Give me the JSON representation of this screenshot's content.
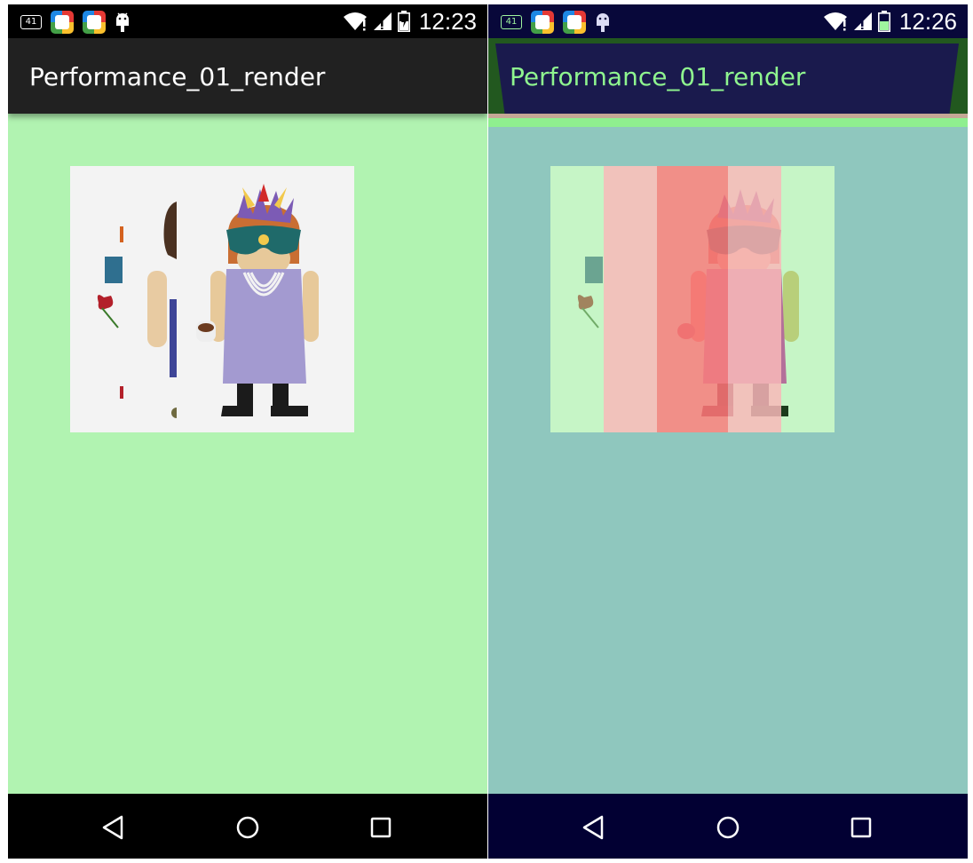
{
  "panels": [
    {
      "status_bar": {
        "notification_count": "41",
        "time": "12:23"
      },
      "app_bar": {
        "title": "Performance_01_render"
      }
    },
    {
      "status_bar": {
        "notification_count": "41",
        "time": "12:26"
      },
      "app_bar": {
        "title": "Performance_01_render"
      },
      "overdraw_colors": [
        "#c6f5c6",
        "#f8b8b8",
        "#f87c7c"
      ]
    }
  ],
  "icons": {
    "status_left": [
      "notification-41-icon",
      "app-store-icon",
      "app-store-icon",
      "android-icon"
    ],
    "status_right": [
      "wifi-icon",
      "signal-icon",
      "battery-icon"
    ],
    "nav": [
      "back-icon",
      "home-icon",
      "recents-icon"
    ]
  },
  "colors": {
    "left_background": "#b1f3b1",
    "right_background": "#8fc7be",
    "left_app_bar": "#212121",
    "right_app_bar": "#1a1a4d",
    "right_title": "#8ff58f"
  }
}
